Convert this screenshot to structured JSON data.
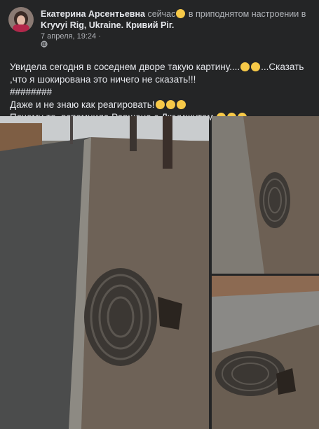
{
  "post": {
    "author": "Екатерина Арсентьевна",
    "activity_time": "сейчас",
    "feeling_text": "в приподнятом настроении в",
    "location": "Kryvyi Rig, Ukraine. Кривий Ріг.",
    "date": "7 апреля, 19:24",
    "dot": "·",
    "body_lines": [
      "Увидела сегодня в соседнем дворе такую картину....",
      "...Сказать ,что я шокирована это ничего не сказать!!!",
      "########",
      "Даже и не знаю как  реагировать!",
      "Почему-то, вспомнила Равшана с Джумшутом"
    ]
  },
  "icons": {
    "avatar": "profile-avatar",
    "feeling_emoji": "smiling-face-emoji",
    "privacy": "globe-icon"
  },
  "colors": {
    "background": "#242526",
    "text_primary": "#e4e6eb",
    "text_secondary": "#b0b3b8",
    "emoji_yellow": "#f7c948"
  }
}
